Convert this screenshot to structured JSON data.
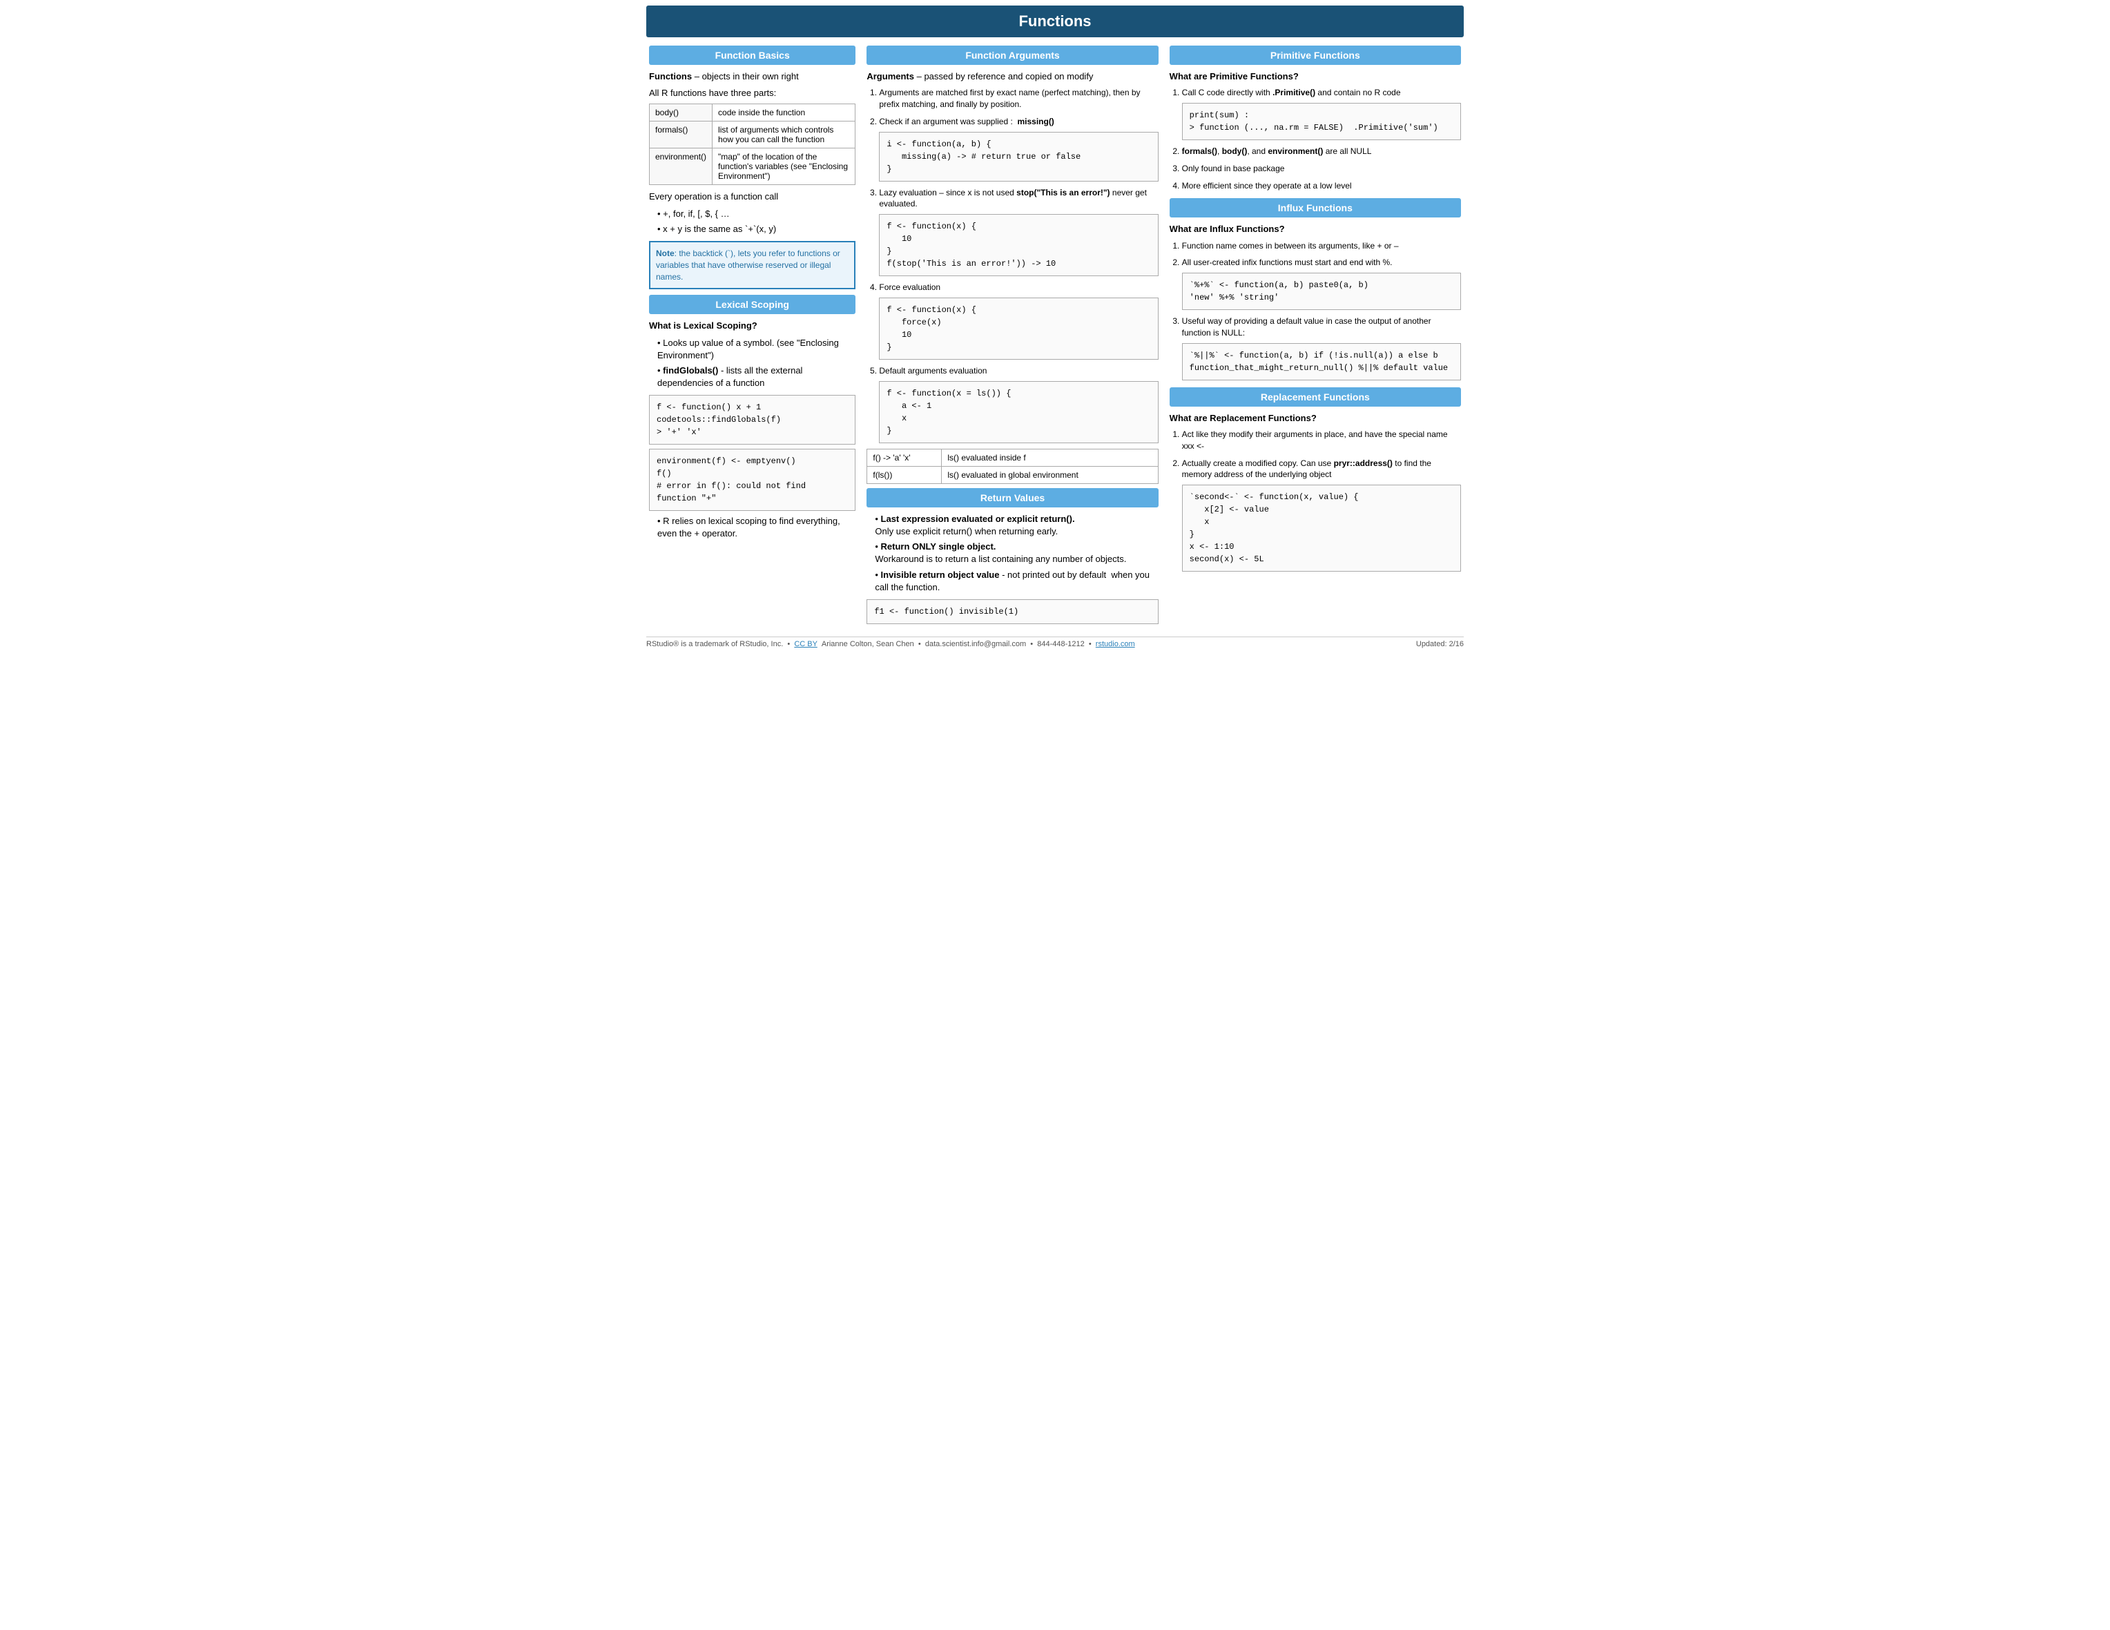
{
  "page": {
    "title": "Functions",
    "footer": {
      "left": "RStudio® is a trademark of RStudio, Inc.  •  CC BY  Arianne Colton, Sean Chen  •  data.scientist.info@gmail.com  •  844-448-1212  •  rstudio.com",
      "right": "Updated: 2/16"
    }
  },
  "col_left": {
    "header": "Function Basics",
    "intro1": "Functions – objects in their own right",
    "intro2": "All R functions have three parts:",
    "table": [
      {
        "name": "body()",
        "desc": "code inside the function"
      },
      {
        "name": "formals()",
        "desc": "list of arguments which controls how you can call the function"
      },
      {
        "name": "environment()",
        "desc": "\"map\" of the location of the function's variables (see \"Enclosing Environment\")"
      }
    ],
    "operation_label": "Every operation is a function call",
    "bullets": [
      "+, for, if, [, $, { …",
      "x + y is the same as `+`(x, y)"
    ],
    "note": "Note: the backtick (`), lets you refer to functions or variables that have otherwise reserved or illegal names.",
    "scoping_header": "Lexical Scoping",
    "scoping_what": "What is Lexical Scoping?",
    "scoping_bullets": [
      "Looks up value of a symbol. (see \"Enclosing Environment\")",
      "findGlobals() - lists all the external dependencies of a function"
    ],
    "scoping_code1": "f <- function() x + 1\ncodetools::findGlobals(f)\n> '+' 'x'",
    "scoping_code2": "environment(f) <- emptyenv()\nf()\n# error in f(): could not find function \"+\"",
    "scoping_note": "R relies on lexical scoping to find everything, even the + operator."
  },
  "col_mid": {
    "header": "Function Arguments",
    "args_intro": "Arguments – passed by reference and copied on modify",
    "args_list": [
      {
        "text": "Arguments are matched first by exact name (perfect matching), then by prefix matching, and finally by position."
      },
      {
        "text": "Check if an argument was supplied :  missing()",
        "code": "i <- function(a, b) {\n   missing(a) -> # return true or false\n}"
      },
      {
        "text": "Lazy evaluation – since x is not used stop(\"This is an error!\") never get evaluated.",
        "code": "f <- function(x) {\n   10\n}\nf(stop('This is an error!')) -> 10"
      },
      {
        "text": "Force evaluation",
        "code": "f <- function(x) {\n   force(x)\n   10\n}"
      },
      {
        "text": "Default arguments evaluation",
        "code": "f <- function(x = ls()) {\n   a <- 1\n   x\n}"
      }
    ],
    "args_table": [
      {
        "col1": "f() -> 'a' 'x'",
        "col2": "ls() evaluated inside f"
      },
      {
        "col1": "f(ls())",
        "col2": "ls() evaluated in global environment"
      }
    ],
    "return_header": "Return Values",
    "return_bullets": [
      {
        "bold": "Last expression evaluated or explicit return().",
        "rest": "Only use explicit return() when returning early."
      },
      {
        "bold": "Return ONLY single object.",
        "rest": "Workaround is to return a list containing any number of objects."
      },
      {
        "bold": "Invisible return object value",
        "rest": "- not printed out by default  when you call the function."
      }
    ],
    "return_code": "f1 <- function() invisible(1)"
  },
  "col_right": {
    "primitive_header": "Primitive Functions",
    "primitive_what": "What are Primitive Functions?",
    "primitive_list": [
      {
        "text": "Call C code directly with .Primitive() and contain no R code"
      },
      {
        "text": "formals(), body(), and environment() are all NULL",
        "bold": true
      },
      {
        "text": "Only found in base package"
      },
      {
        "text": "More efficient since they operate at a low level"
      }
    ],
    "primitive_code": "print(sum) :\n> function (..., na.rm = FALSE)  .Primitive('sum')",
    "influx_header": "Influx Functions",
    "influx_what": "What are Influx Functions?",
    "influx_list": [
      {
        "text": "Function name comes in between its arguments, like + or –"
      },
      {
        "text": "All user-created infix functions must start and end with %."
      },
      {
        "text": "Useful way of providing a default value in case the output of another function is NULL:"
      }
    ],
    "influx_code1": "`%+%` <- function(a, b) paste0(a, b)\n'new' %+% 'string'",
    "influx_code2": "`%||%` <- function(a, b) if (!is.null(a)) a else b\nfunction_that_might_return_null() %||% default value",
    "replacement_header": "Replacement Functions",
    "replacement_what": "What are Replacement Functions?",
    "replacement_list": [
      {
        "text": "Act like they modify their arguments in place, and have the special name xxx <-"
      },
      {
        "text": "Actually create a modified copy. Can use pryr::address() to find the memory address of the underlying object"
      }
    ],
    "replacement_code": "`second<-` <- function(x, value) {\n   x[2] <- value\n   x\n}\nx <- 1:10\nsecond(x) <- 5L"
  }
}
